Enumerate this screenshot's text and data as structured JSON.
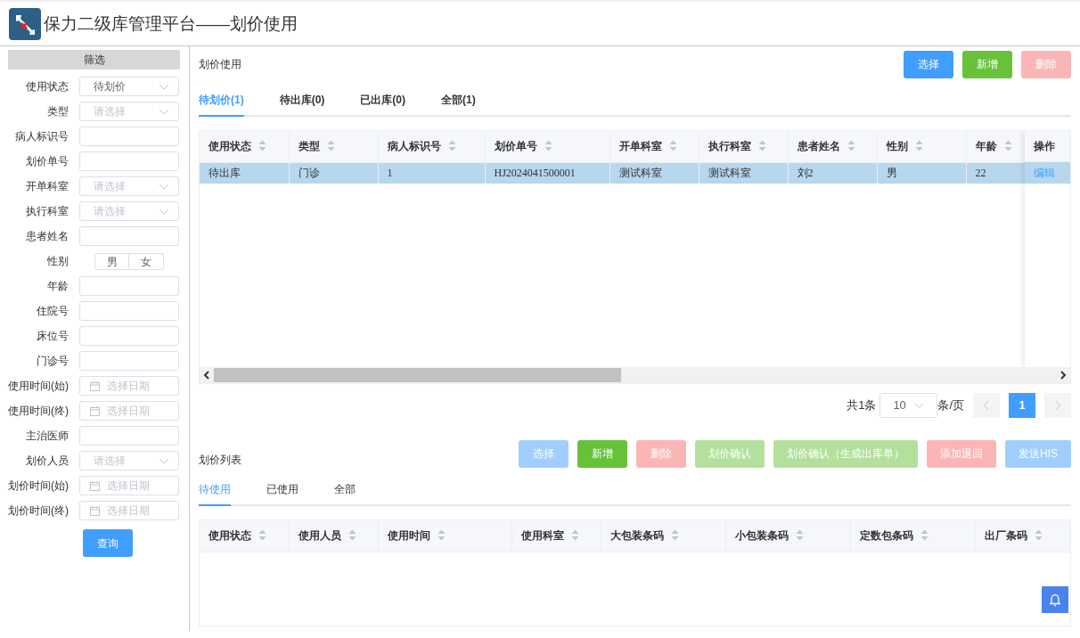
{
  "header": {
    "title": "保力二级库管理平台——划价使用"
  },
  "filter": {
    "title": "筛选",
    "fields": [
      {
        "label": "使用状态",
        "kind": "select",
        "value": "待划价"
      },
      {
        "label": "类型",
        "kind": "select",
        "placeholder": "请选择"
      },
      {
        "label": "病人标识号",
        "kind": "input"
      },
      {
        "label": "划价单号",
        "kind": "input"
      },
      {
        "label": "开单科室",
        "kind": "select",
        "placeholder": "请选择"
      },
      {
        "label": "执行科室",
        "kind": "select",
        "placeholder": "请选择"
      },
      {
        "label": "患者姓名",
        "kind": "input"
      },
      {
        "label": "性别",
        "kind": "toggle",
        "options": [
          {
            "label": "男",
            "selected": false
          },
          {
            "label": "女",
            "selected": false
          }
        ]
      },
      {
        "label": "年龄",
        "kind": "input"
      },
      {
        "label": "住院号",
        "kind": "input"
      },
      {
        "label": "床位号",
        "kind": "input"
      },
      {
        "label": "门诊号",
        "kind": "input"
      },
      {
        "label": "使用时间(始)",
        "kind": "date",
        "placeholder": "选择日期"
      },
      {
        "label": "使用时间(终)",
        "kind": "date",
        "placeholder": "选择日期"
      },
      {
        "label": "主治医师",
        "kind": "input"
      },
      {
        "label": "划价人员",
        "kind": "select",
        "placeholder": "请选择"
      },
      {
        "label": "划价时间(始)",
        "kind": "date",
        "placeholder": "选择日期"
      },
      {
        "label": "划价时间(终)",
        "kind": "date",
        "placeholder": "选择日期"
      }
    ],
    "submit": "查询"
  },
  "usage": {
    "title": "划价使用",
    "buttons": [
      {
        "label": "选择",
        "kind": "primary",
        "disabled": false
      },
      {
        "label": "新增",
        "kind": "success",
        "disabled": false
      },
      {
        "label": "删除",
        "kind": "danger",
        "disabled": true
      }
    ],
    "tabs": [
      {
        "label": "待划价(1)",
        "selected": true
      },
      {
        "label": "待出库(0)",
        "selected": false
      },
      {
        "label": "已出库(0)",
        "selected": false
      },
      {
        "label": "全部(1)",
        "selected": false
      }
    ],
    "table": {
      "columns": [
        "使用状态",
        "类型",
        "病人标识号",
        "划价单号",
        "开单科室",
        "执行科室",
        "患者姓名",
        "性别",
        "年龄"
      ],
      "action_column": "操作",
      "rows": [
        {
          "cells": [
            "待出库",
            "门诊",
            "1",
            "HJ2024041500001",
            "测试科室",
            "测试科室",
            "刘2",
            "男",
            "22"
          ],
          "action": "编辑",
          "selected": true
        }
      ]
    },
    "pagination": {
      "total": "共1条",
      "page_size": "10",
      "page_size_suffix": "条/页",
      "pages": [
        {
          "label": "1",
          "selected": true
        }
      ]
    }
  },
  "list": {
    "title": "划价列表",
    "buttons": [
      {
        "label": "选择",
        "kind": "primary",
        "disabled": true
      },
      {
        "label": "新增",
        "kind": "success",
        "disabled": false
      },
      {
        "label": "删除",
        "kind": "danger",
        "disabled": true
      },
      {
        "label": "划价确认",
        "kind": "success",
        "disabled": true
      },
      {
        "label": "划价确认（生成出库单）",
        "kind": "success",
        "disabled": true
      },
      {
        "label": "添加退回",
        "kind": "danger",
        "disabled": true
      },
      {
        "label": "发送HIS",
        "kind": "primary",
        "disabled": true
      }
    ],
    "tabs": [
      {
        "label": "待使用",
        "selected": true
      },
      {
        "label": "已使用",
        "selected": false
      },
      {
        "label": "全部",
        "selected": false
      }
    ],
    "table": {
      "columns": [
        "使用状态",
        "使用人员",
        "使用时间",
        "使用科室",
        "大包装条码",
        "小包装条码",
        "定数包条码",
        "出厂条码"
      ]
    }
  }
}
